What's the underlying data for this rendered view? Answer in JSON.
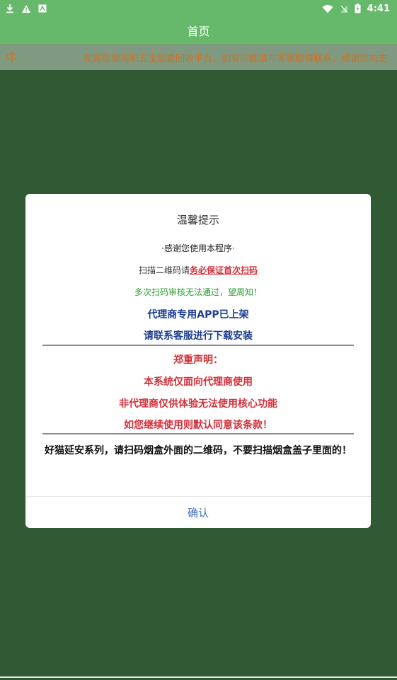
{
  "status_bar": {
    "time": "4:41",
    "left_icons": [
      "download-icon",
      "warning-icon",
      "app-notification-icon"
    ],
    "right_icons": [
      "wifi-icon",
      "no-signal-icon",
      "battery-icon"
    ]
  },
  "app_bar": {
    "title": "首页"
  },
  "notice": {
    "icon": "speaker-icon",
    "text": "欢迎您使用和五宝烟盒回收平台，如有问题请与客服取得联系，感谢您的支"
  },
  "dialog": {
    "title": "温馨提示",
    "thanks": "·感谢您使用本程序·",
    "scan_prefix": "扫描二维码请",
    "scan_warning": "务必保证首次扫码",
    "multi_scan": "多次扫码审核无法通过，望周知！",
    "agent_app": "代理商专用APP已上架",
    "contact_service": "请联系客服进行下载安装",
    "declaration_title": "郑重声明：",
    "declaration_1": "本系统仅面向代理商使用",
    "declaration_2": "非代理商仅供体验无法使用核心功能",
    "declaration_3": "如您继续使用则默认同意该条款！",
    "note": "好猫延安系列，请扫码烟盒外面的二维码，不要扫描烟盒盖子里面的！",
    "confirm_label": "确认"
  },
  "colors": {
    "header_green": "#66b86b",
    "background_green": "#2f5a34",
    "warning_red": "#d2303a",
    "info_blue": "#1c3f8f",
    "hint_green": "#2a9d2f",
    "link_blue": "#3d73b6"
  }
}
